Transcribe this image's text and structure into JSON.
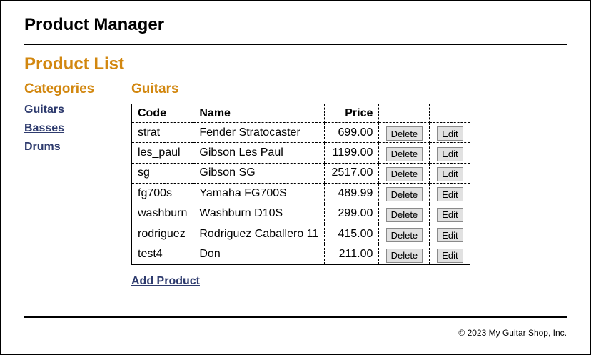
{
  "header": {
    "title": "Product Manager"
  },
  "main": {
    "heading": "Product List",
    "categories_heading": "Categories",
    "categories": [
      "Guitars",
      "Basses",
      "Drums"
    ],
    "current_category": "Guitars",
    "table": {
      "headers": [
        "Code",
        "Name",
        "Price"
      ],
      "delete_label": "Delete",
      "edit_label": "Edit",
      "rows": [
        [
          "strat",
          "Fender Stratocaster",
          "699.00"
        ],
        [
          "les_paul",
          "Gibson Les Paul",
          "1199.00"
        ],
        [
          "sg",
          "Gibson SG",
          "2517.00"
        ],
        [
          "fg700s",
          "Yamaha FG700S",
          "489.99"
        ],
        [
          "washburn",
          "Washburn D10S",
          "299.00"
        ],
        [
          "rodriguez",
          "Rodriguez Caballero 11",
          "415.00"
        ],
        [
          "test4",
          "Don",
          "211.00"
        ]
      ]
    },
    "add_product": "Add Product"
  },
  "footer": {
    "text": "© 2023 My Guitar Shop, Inc."
  },
  "colors": {
    "heading": "#d2870f",
    "link": "#2e3b6e"
  }
}
